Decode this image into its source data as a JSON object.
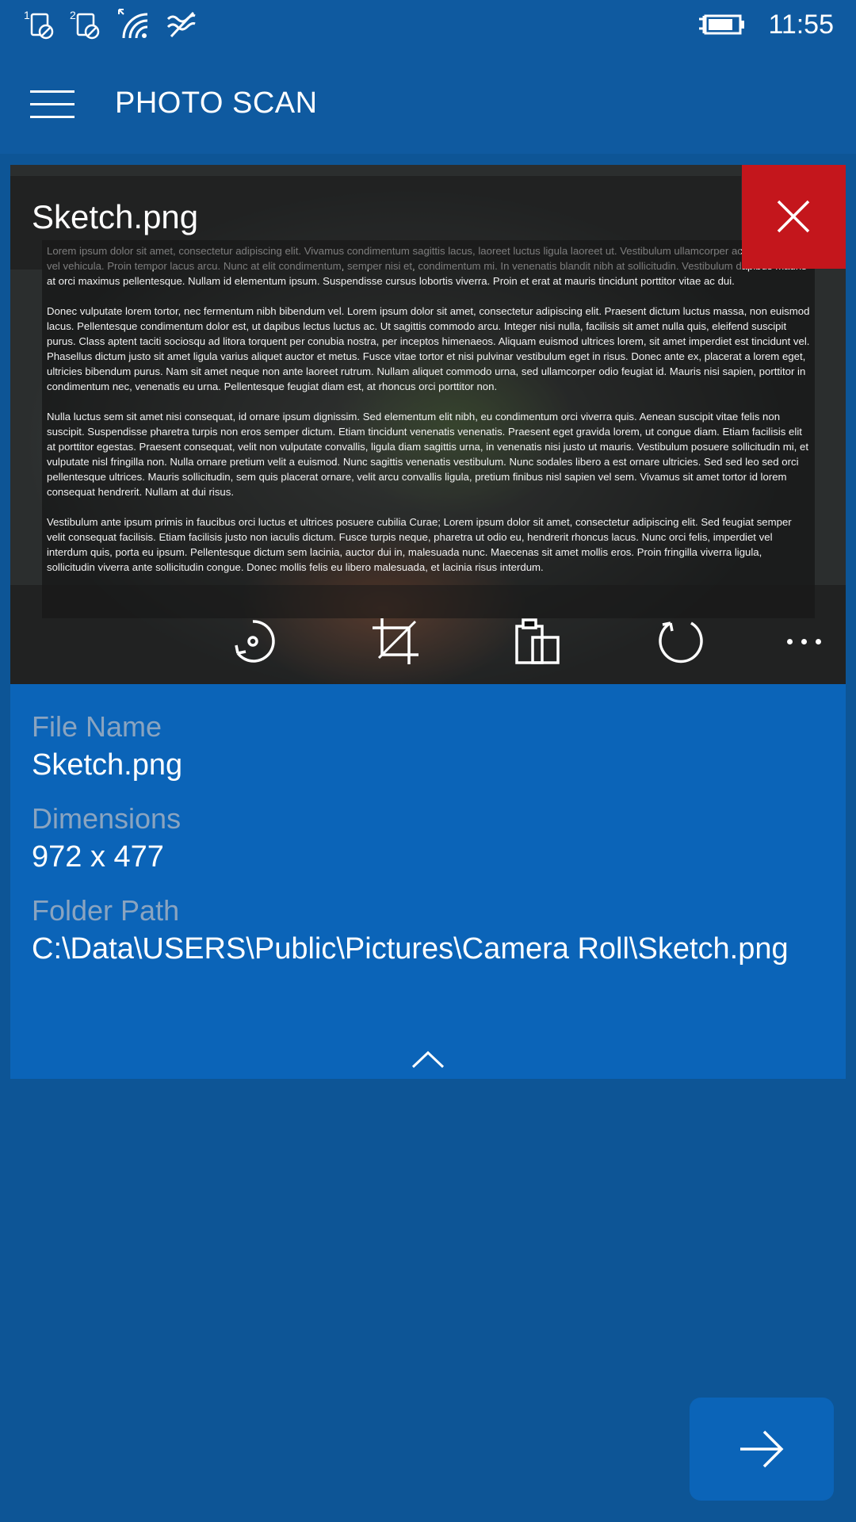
{
  "status_bar": {
    "time": "11:55",
    "icons": [
      "sim1-blocked-icon",
      "sim2-blocked-icon",
      "wifi-icon",
      "flight-mode-icon",
      "battery-charging-icon"
    ]
  },
  "app_bar": {
    "title": "PHOTO SCAN",
    "menu_icon": "hamburger-icon"
  },
  "preview": {
    "file_title": "Sketch.png",
    "close_icon": "close-icon",
    "document_paragraphs": [
      "Lorem ipsum dolor sit amet, consectetur adipiscing elit. Vivamus condimentum sagittis lacus, laoreet luctus ligula laoreet ut. Vestibulum ullamcorper accumsan velit vel vehicula. Proin tempor lacus arcu. Nunc at elit condimentum, semper nisi et, condimentum mi. In venenatis blandit nibh at sollicitudin. Vestibulum dapibus mauris at orci maximus pellentesque. Nullam id elementum ipsum. Suspendisse cursus lobortis viverra. Proin et erat at mauris tincidunt porttitor vitae ac dui.",
      "Donec vulputate lorem tortor, nec fermentum nibh bibendum vel. Lorem ipsum dolor sit amet, consectetur adipiscing elit. Praesent dictum luctus massa, non euismod lacus. Pellentesque condimentum dolor est, ut dapibus lectus luctus ac. Ut sagittis commodo arcu. Integer nisi nulla, facilisis sit amet nulla quis, eleifend suscipit purus. Class aptent taciti sociosqu ad litora torquent per conubia nostra, per inceptos himenaeos. Aliquam euismod ultrices lorem, sit amet imperdiet est tincidunt vel. Phasellus dictum justo sit amet ligula varius aliquet auctor et metus. Fusce vitae tortor et nisi pulvinar vestibulum eget in risus. Donec ante ex, placerat a lorem eget, ultricies bibendum purus. Nam sit amet neque non ante laoreet rutrum. Nullam aliquet commodo urna, sed ullamcorper odio feugiat id. Mauris nisi sapien, porttitor in condimentum nec, venenatis eu urna. Pellentesque feugiat diam est, at rhoncus orci porttitor non.",
      "Nulla luctus sem sit amet nisi consequat, id ornare ipsum dignissim. Sed elementum elit nibh, eu condimentum orci viverra quis. Aenean suscipit vitae felis non suscipit. Suspendisse pharetra turpis non eros semper dictum. Etiam tincidunt venenatis venenatis. Praesent eget gravida lorem, ut congue diam. Etiam facilisis elit at porttitor egestas. Praesent consequat, velit non vulputate convallis, ligula diam sagittis urna, in venenatis nisi justo ut mauris. Vestibulum posuere sollicitudin mi, et vulputate nisl fringilla non. Nulla ornare pretium velit a euismod. Nunc sagittis venenatis vestibulum. Nunc sodales libero a est ornare ultricies. Sed sed leo sed orci pellentesque ultrices. Mauris sollicitudin, sem quis placerat ornare, velit arcu convallis ligula, pretium finibus nisl sapien vel sem. Vivamus sit amet tortor id lorem consequat hendrerit. Nullam at dui risus.",
      "Vestibulum ante ipsum primis in faucibus orci luctus et ultrices posuere cubilia Curae; Lorem ipsum dolor sit amet, consectetur adipiscing elit. Sed feugiat semper velit consequat facilisis. Etiam facilisis justo non iaculis dictum. Fusce turpis neque, pharetra ut odio eu, hendrerit rhoncus lacus. Nunc orci felis, imperdiet vel interdum quis, porta eu ipsum. Pellentesque dictum sem lacinia, auctor dui in, malesuada nunc. Maecenas sit amet mollis eros. Proin fringilla viverra ligula, sollicitudin viverra ante sollicitudin congue. Donec mollis felis eu libero malesuada, et lacinia risus interdum."
    ],
    "toolbar": [
      "filter-icon",
      "crop-icon",
      "paste-icon",
      "rotate-icon",
      "more-icon"
    ]
  },
  "info": {
    "file_name_label": "File Name",
    "file_name_value": "Sketch.png",
    "dimensions_label": "Dimensions",
    "dimensions_value": "972 x 477",
    "folder_path_label": "Folder Path",
    "folder_path_value": "C:\\Data\\USERS\\Public\\Pictures\\Camera Roll\\Sketch.png"
  },
  "collapse_icon": "chevron-up-icon",
  "next_icon": "arrow-right-icon",
  "colors": {
    "background": "#0d5596",
    "card": "#0b64b8",
    "close_button": "#c4161c",
    "label": "#8aa4c0"
  }
}
